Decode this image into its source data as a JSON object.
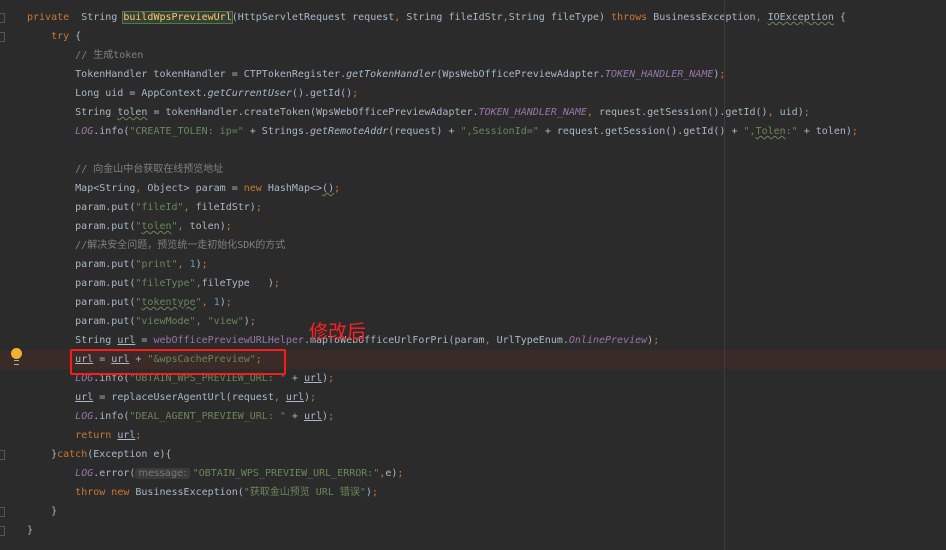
{
  "editor": {
    "lines": [
      [
        [
          "private",
          "k"
        ],
        [
          "  String ",
          "d"
        ],
        [
          "buildWpsPreviewUrl",
          "h"
        ],
        [
          "(HttpServletRequest request",
          "d"
        ],
        [
          ",",
          "k"
        ],
        [
          " String fileIdStr",
          "d"
        ],
        [
          ",",
          "k"
        ],
        [
          "String fileType) ",
          "d"
        ],
        [
          "throws",
          "k"
        ],
        [
          " BusinessException",
          "d"
        ],
        [
          ",",
          "k"
        ],
        [
          " ",
          "d"
        ],
        [
          "IOException",
          "w"
        ],
        [
          " {",
          "d"
        ]
      ],
      [
        [
          "    ",
          "d"
        ],
        [
          "try",
          "k"
        ],
        [
          " {",
          "d"
        ]
      ],
      [
        [
          "        ",
          "d"
        ],
        [
          "// 生成token",
          "c"
        ]
      ],
      [
        [
          "        TokenHandler tokenHandler = CTPTokenRegister.",
          "d"
        ],
        [
          "getTokenHandler",
          "i"
        ],
        [
          "(WpsWebOfficePreviewAdapter.",
          "d"
        ],
        [
          "TOKEN_HANDLER_NAME",
          "p"
        ],
        [
          ")",
          "d"
        ],
        [
          ";",
          "k"
        ]
      ],
      [
        [
          "        Long uid = AppContext.",
          "d"
        ],
        [
          "getCurrentUser",
          "i"
        ],
        [
          "().getId()",
          "d"
        ],
        [
          ";",
          "k"
        ]
      ],
      [
        [
          "        String ",
          "d"
        ],
        [
          "tolen",
          "w"
        ],
        [
          " = tokenHandler.createToken(WpsWebOfficePreviewAdapter.",
          "d"
        ],
        [
          "TOKEN_HANDLER_NAME",
          "p"
        ],
        [
          ",",
          "k"
        ],
        [
          " request.getSession().getId()",
          "d"
        ],
        [
          ",",
          "k"
        ],
        [
          " uid)",
          "d"
        ],
        [
          ";",
          "k"
        ]
      ],
      [
        [
          "        ",
          "d"
        ],
        [
          "LOG",
          "p"
        ],
        [
          ".info(",
          "d"
        ],
        [
          "\"CREATE_TOLEN: ip=\"",
          "s"
        ],
        [
          " + Strings.",
          "d"
        ],
        [
          "getRemoteAddr",
          "i"
        ],
        [
          "(request) + ",
          "d"
        ],
        [
          "\",SessionId=\"",
          "s"
        ],
        [
          " + request.getSession().getId() + ",
          "d"
        ],
        [
          "\",",
          "s"
        ],
        [
          "Tolen",
          "ws"
        ],
        [
          ":\"",
          "s"
        ],
        [
          " + tolen)",
          "d"
        ],
        [
          ";",
          "k"
        ]
      ],
      [],
      [
        [
          "        ",
          "d"
        ],
        [
          "// 向金山中台获取在线预览地址",
          "c"
        ]
      ],
      [
        [
          "        Map<String",
          "d"
        ],
        [
          ",",
          "k"
        ],
        [
          " Object> param = ",
          "d"
        ],
        [
          "new",
          "k"
        ],
        [
          " HashMap<>",
          "d"
        ],
        [
          "()",
          "w"
        ],
        [
          ";",
          "k"
        ]
      ],
      [
        [
          "        param.put(",
          "d"
        ],
        [
          "\"fileId\"",
          "s"
        ],
        [
          ",",
          "k"
        ],
        [
          " fileIdStr)",
          "d"
        ],
        [
          ";",
          "k"
        ]
      ],
      [
        [
          "        param.put(",
          "d"
        ],
        [
          "\"",
          "s"
        ],
        [
          "tolen",
          "ws"
        ],
        [
          "\"",
          "s"
        ],
        [
          ",",
          "k"
        ],
        [
          " tolen)",
          "d"
        ],
        [
          ";",
          "k"
        ]
      ],
      [
        [
          "        ",
          "d"
        ],
        [
          "//解决安全问题，预览统一走初始化SDK的方式",
          "c"
        ]
      ],
      [
        [
          "        param.put(",
          "d"
        ],
        [
          "\"print\"",
          "s"
        ],
        [
          ",",
          "k"
        ],
        [
          " ",
          "d"
        ],
        [
          "1",
          "n"
        ],
        [
          ")",
          "d"
        ],
        [
          ";",
          "k"
        ]
      ],
      [
        [
          "        param.put(",
          "d"
        ],
        [
          "\"fileType\"",
          "s"
        ],
        [
          ",",
          "k"
        ],
        [
          "fileType   )",
          "d"
        ],
        [
          ";",
          "k"
        ]
      ],
      [
        [
          "        param.put(",
          "d"
        ],
        [
          "\"",
          "s"
        ],
        [
          "tokentype",
          "ws"
        ],
        [
          "\"",
          "s"
        ],
        [
          ",",
          "k"
        ],
        [
          " ",
          "d"
        ],
        [
          "1",
          "n"
        ],
        [
          ")",
          "d"
        ],
        [
          ";",
          "k"
        ]
      ],
      [
        [
          "        param.put(",
          "d"
        ],
        [
          "\"viewMode\"",
          "s"
        ],
        [
          ",",
          "k"
        ],
        [
          " ",
          "d"
        ],
        [
          "\"view\"",
          "s"
        ],
        [
          ")",
          "d"
        ],
        [
          ";",
          "k"
        ]
      ],
      [
        [
          "        String ",
          "d"
        ],
        [
          "url",
          "u"
        ],
        [
          " = ",
          "d"
        ],
        [
          "webOfficePreviewURLHelper",
          "p2"
        ],
        [
          ".mapToWebOfficeUrlForPri(param",
          "d"
        ],
        [
          ",",
          "k"
        ],
        [
          " UrlTypeEnum.",
          "d"
        ],
        [
          "OnlinePreview",
          "p"
        ],
        [
          ")",
          "d"
        ],
        [
          ";",
          "k"
        ]
      ],
      [
        [
          "        ",
          "d"
        ],
        [
          "url",
          "u"
        ],
        [
          " = ",
          "d"
        ],
        [
          "url",
          "u"
        ],
        [
          " + ",
          "d"
        ],
        [
          "\"&wpsCachePreview\"",
          "s"
        ],
        [
          ";",
          "k"
        ]
      ],
      [
        [
          "        ",
          "d"
        ],
        [
          "LOG",
          "p"
        ],
        [
          ".info(",
          "d"
        ],
        [
          "\"OBTAIN_WPS_PREVIEW_URL: \"",
          "s"
        ],
        [
          " + ",
          "d"
        ],
        [
          "url",
          "u"
        ],
        [
          ")",
          "d"
        ],
        [
          ";",
          "k"
        ]
      ],
      [
        [
          "        ",
          "d"
        ],
        [
          "url",
          "u"
        ],
        [
          " = replaceUserAgentUrl(request",
          "d"
        ],
        [
          ",",
          "k"
        ],
        [
          " ",
          "d"
        ],
        [
          "url",
          "u"
        ],
        [
          ")",
          "d"
        ],
        [
          ";",
          "k"
        ]
      ],
      [
        [
          "        ",
          "d"
        ],
        [
          "LOG",
          "p"
        ],
        [
          ".info(",
          "d"
        ],
        [
          "\"DEAL_AGENT_PREVIEW_URL: \"",
          "s"
        ],
        [
          " + ",
          "d"
        ],
        [
          "url",
          "u"
        ],
        [
          ")",
          "d"
        ],
        [
          ";",
          "k"
        ]
      ],
      [
        [
          "        ",
          "d"
        ],
        [
          "return",
          "k"
        ],
        [
          " ",
          "d"
        ],
        [
          "url",
          "u"
        ],
        [
          ";",
          "k"
        ]
      ],
      [
        [
          "    }",
          "d"
        ],
        [
          "catch",
          "k"
        ],
        [
          "(Exception e){",
          "d"
        ]
      ],
      [
        [
          "        ",
          "d"
        ],
        [
          "LOG",
          "p"
        ],
        [
          ".error(",
          "d"
        ],
        [
          "message:",
          "hint"
        ],
        [
          "\"OBTAIN_WPS_PREVIEW_URL_ERROR:\"",
          "s"
        ],
        [
          ",",
          "k"
        ],
        [
          "e)",
          "d"
        ],
        [
          ";",
          "k"
        ]
      ],
      [
        [
          "        ",
          "d"
        ],
        [
          "throw new",
          "k"
        ],
        [
          " BusinessException(",
          "d"
        ],
        [
          "\"获取金山预览 URL 错误\"",
          "s"
        ],
        [
          ")",
          "d"
        ],
        [
          ";",
          "k"
        ]
      ],
      [
        [
          "    }",
          "d"
        ]
      ],
      [
        [
          "}",
          "d"
        ]
      ]
    ],
    "highlighted_line": 19,
    "fold_lines": [
      1,
      2,
      24,
      27,
      28
    ]
  },
  "annotation": {
    "text": "修改后",
    "color": "#ff2020"
  },
  "colors": {
    "background": "#2b2b2b",
    "keyword": "#cc7832",
    "string": "#6a8759",
    "comment": "#808080",
    "field": "#9876aa",
    "number": "#6897bb",
    "default": "#a9b7c6"
  }
}
